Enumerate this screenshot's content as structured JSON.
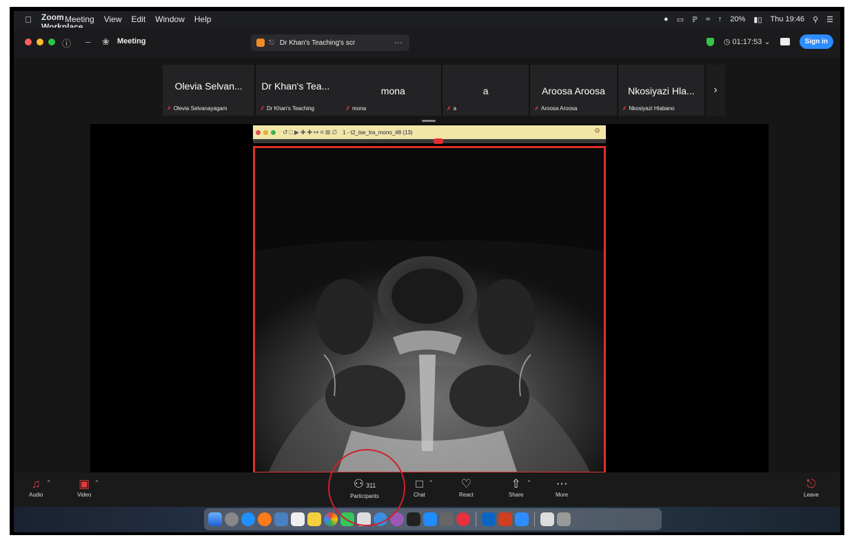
{
  "menubar": {
    "app_name": "Zoom Workplace",
    "items": [
      "Meeting",
      "View",
      "Edit",
      "Window",
      "Help"
    ],
    "battery": "20%",
    "clock": "Thu 19:46"
  },
  "titlebar": {
    "meeting_label": "Meeting",
    "share_tab_label": "Dr Khan's Teaching's scr",
    "timer": "01:17:53",
    "signin_label": "Sign in"
  },
  "participants": [
    {
      "name": "Olevia Selvan...",
      "sub": "Olevia Selvanayagam"
    },
    {
      "name": "Dr Khan's Tea...",
      "sub": "Dr Khan's Teaching"
    },
    {
      "name": "mona",
      "sub": "mona"
    },
    {
      "name": "a",
      "sub": "a"
    },
    {
      "name": "Aroosa Aroosa",
      "sub": "Aroosa Aroosa"
    },
    {
      "name": "Nkosiyazi Hla...",
      "sub": "Nkosiyazi Hlabano"
    }
  ],
  "viewer": {
    "file_label": "1 - t2_tse_tra_mono_#8 (13)"
  },
  "toolbar": {
    "audio_label": "Audio",
    "video_label": "Video",
    "participants_label": "Participants",
    "participants_count": "311",
    "chat_label": "Chat",
    "react_label": "React",
    "share_label": "Share",
    "more_label": "More",
    "leave_label": "Leave"
  },
  "colors": {
    "accent_blue": "#2d8cff",
    "mute_red": "#e23b3b",
    "share_border": "#e0302a",
    "annotation": "#d0202a"
  }
}
